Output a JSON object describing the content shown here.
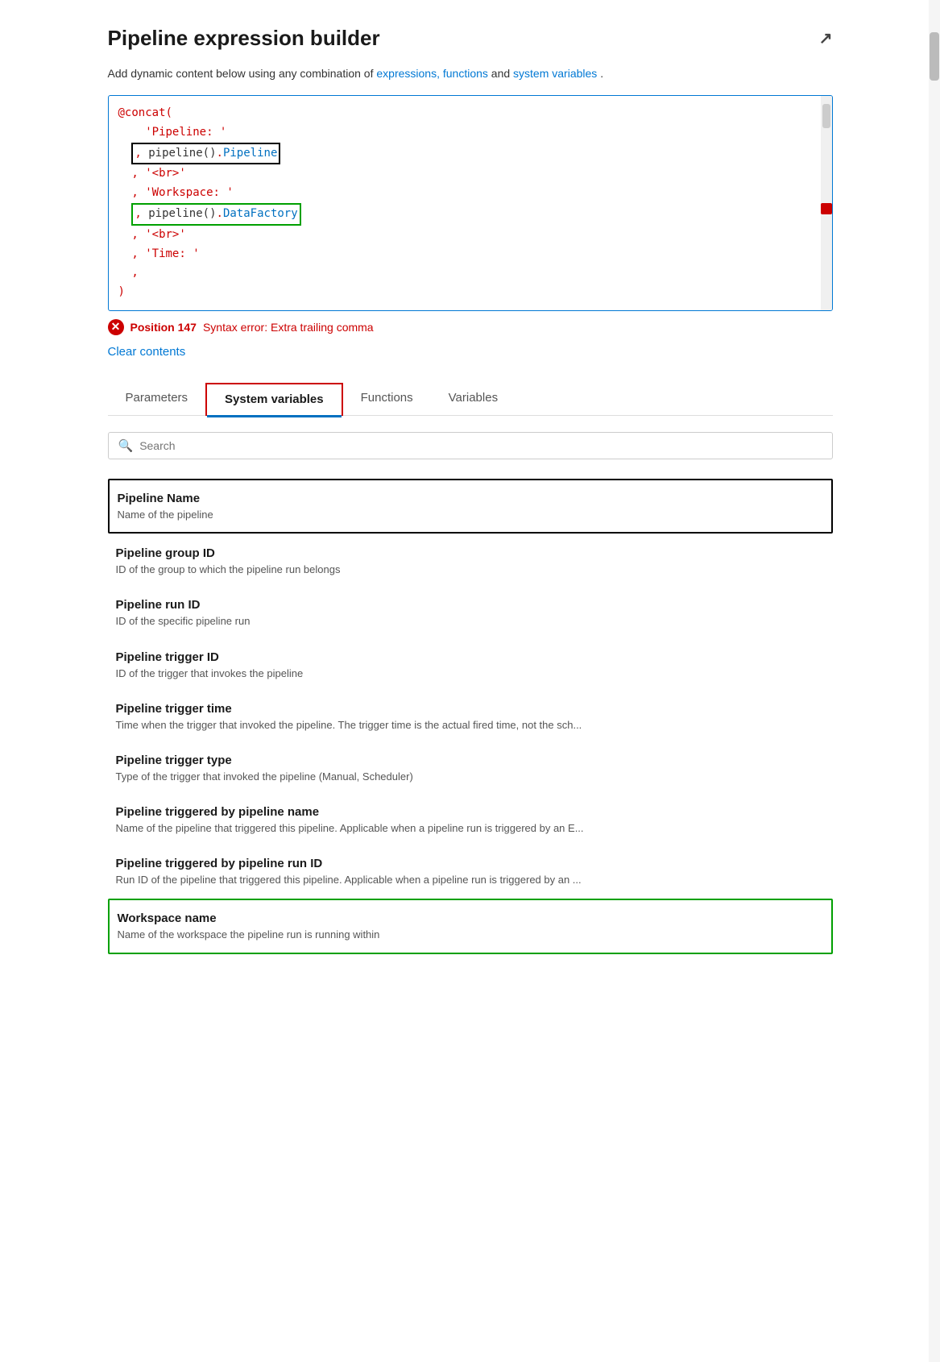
{
  "panel": {
    "title": "Pipeline expression builder",
    "expand_label": "↗"
  },
  "description": {
    "text_before": "Add dynamic content below using any combination of ",
    "link1": "expressions, functions",
    "text_middle": " and ",
    "link2": "system variables",
    "text_after": "."
  },
  "code": {
    "lines": "@concat(\n    'Pipeline: '\n  , pipeline().Pipeline\n  , '<br>'\n  , 'Workspace: '\n  , pipeline().DataFactory\n  , '<br>'\n  , 'Time: '\n  ,\n)"
  },
  "error": {
    "icon": "✕",
    "position_label": "Position 147",
    "message": "Syntax error: Extra trailing comma"
  },
  "clear_contents_label": "Clear contents",
  "tabs": [
    {
      "label": "Parameters",
      "active": false
    },
    {
      "label": "System variables",
      "active": true
    },
    {
      "label": "Functions",
      "active": false
    },
    {
      "label": "Variables",
      "active": false
    }
  ],
  "search": {
    "placeholder": "Search"
  },
  "variables": [
    {
      "name": "Pipeline Name",
      "desc": "Name of the pipeline",
      "highlight": "black"
    },
    {
      "name": "Pipeline group ID",
      "desc": "ID of the group to which the pipeline run belongs",
      "highlight": ""
    },
    {
      "name": "Pipeline run ID",
      "desc": "ID of the specific pipeline run",
      "highlight": ""
    },
    {
      "name": "Pipeline trigger ID",
      "desc": "ID of the trigger that invokes the pipeline",
      "highlight": ""
    },
    {
      "name": "Pipeline trigger time",
      "desc": "Time when the trigger that invoked the pipeline. The trigger time is the actual fired time, not the sch...",
      "highlight": ""
    },
    {
      "name": "Pipeline trigger type",
      "desc": "Type of the trigger that invoked the pipeline (Manual, Scheduler)",
      "highlight": ""
    },
    {
      "name": "Pipeline triggered by pipeline name",
      "desc": "Name of the pipeline that triggered this pipeline. Applicable when a pipeline run is triggered by an E...",
      "highlight": ""
    },
    {
      "name": "Pipeline triggered by pipeline run ID",
      "desc": "Run ID of the pipeline that triggered this pipeline. Applicable when a pipeline run is triggered by an ...",
      "highlight": ""
    },
    {
      "name": "Workspace name",
      "desc": "Name of the workspace the pipeline run is running within",
      "highlight": "green"
    }
  ]
}
